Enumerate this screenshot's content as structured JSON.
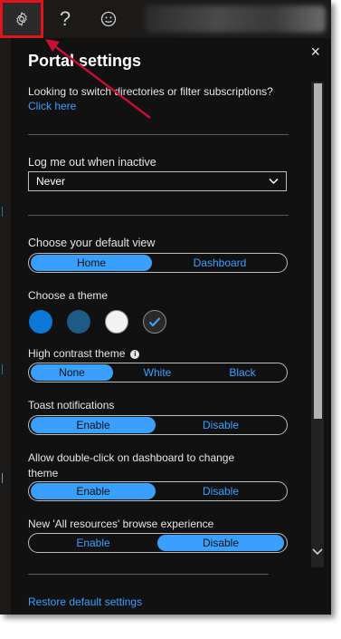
{
  "topbar": {
    "help_label": "?"
  },
  "panel": {
    "title": "Portal settings",
    "close_glyph": "×",
    "directories_text": "Looking to switch directories or filter subscriptions?",
    "click_here_link": "Click here",
    "inactive_label": "Log me out when inactive",
    "inactive_value": "Never",
    "default_view_label": "Choose your default view",
    "default_view_options": [
      "Home",
      "Dashboard"
    ],
    "theme_label": "Choose a theme",
    "high_contrast_label": "High contrast theme",
    "high_contrast_options": [
      "None",
      "White",
      "Black"
    ],
    "toast_label": "Toast notifications",
    "toast_options": [
      "Enable",
      "Disable"
    ],
    "doubleclick_label_line1": "Allow double-click on dashboard to change",
    "doubleclick_label_line2": "theme",
    "doubleclick_options": [
      "Enable",
      "Disable"
    ],
    "all_resources_label": "New 'All resources' browse experience",
    "all_resources_options": [
      "Enable",
      "Disable"
    ],
    "restore_link": "Restore default settings"
  },
  "theme_swatches": [
    {
      "name": "azure-blue",
      "color": "#0a78d4"
    },
    {
      "name": "dark-blue",
      "color": "#1e5b84"
    },
    {
      "name": "light",
      "color": "#f2f2f2"
    },
    {
      "name": "dark",
      "color": "#2a2a2a",
      "selected": true
    }
  ],
  "colors": {
    "accent": "#3aa0ff",
    "highlight_border": "#e0141e",
    "annotation_arrow": "#c8102e"
  },
  "icons": [
    "gear-icon",
    "help-icon",
    "smiley-icon",
    "close-icon",
    "chevron-down-icon",
    "info-icon",
    "checkmark-icon"
  ]
}
